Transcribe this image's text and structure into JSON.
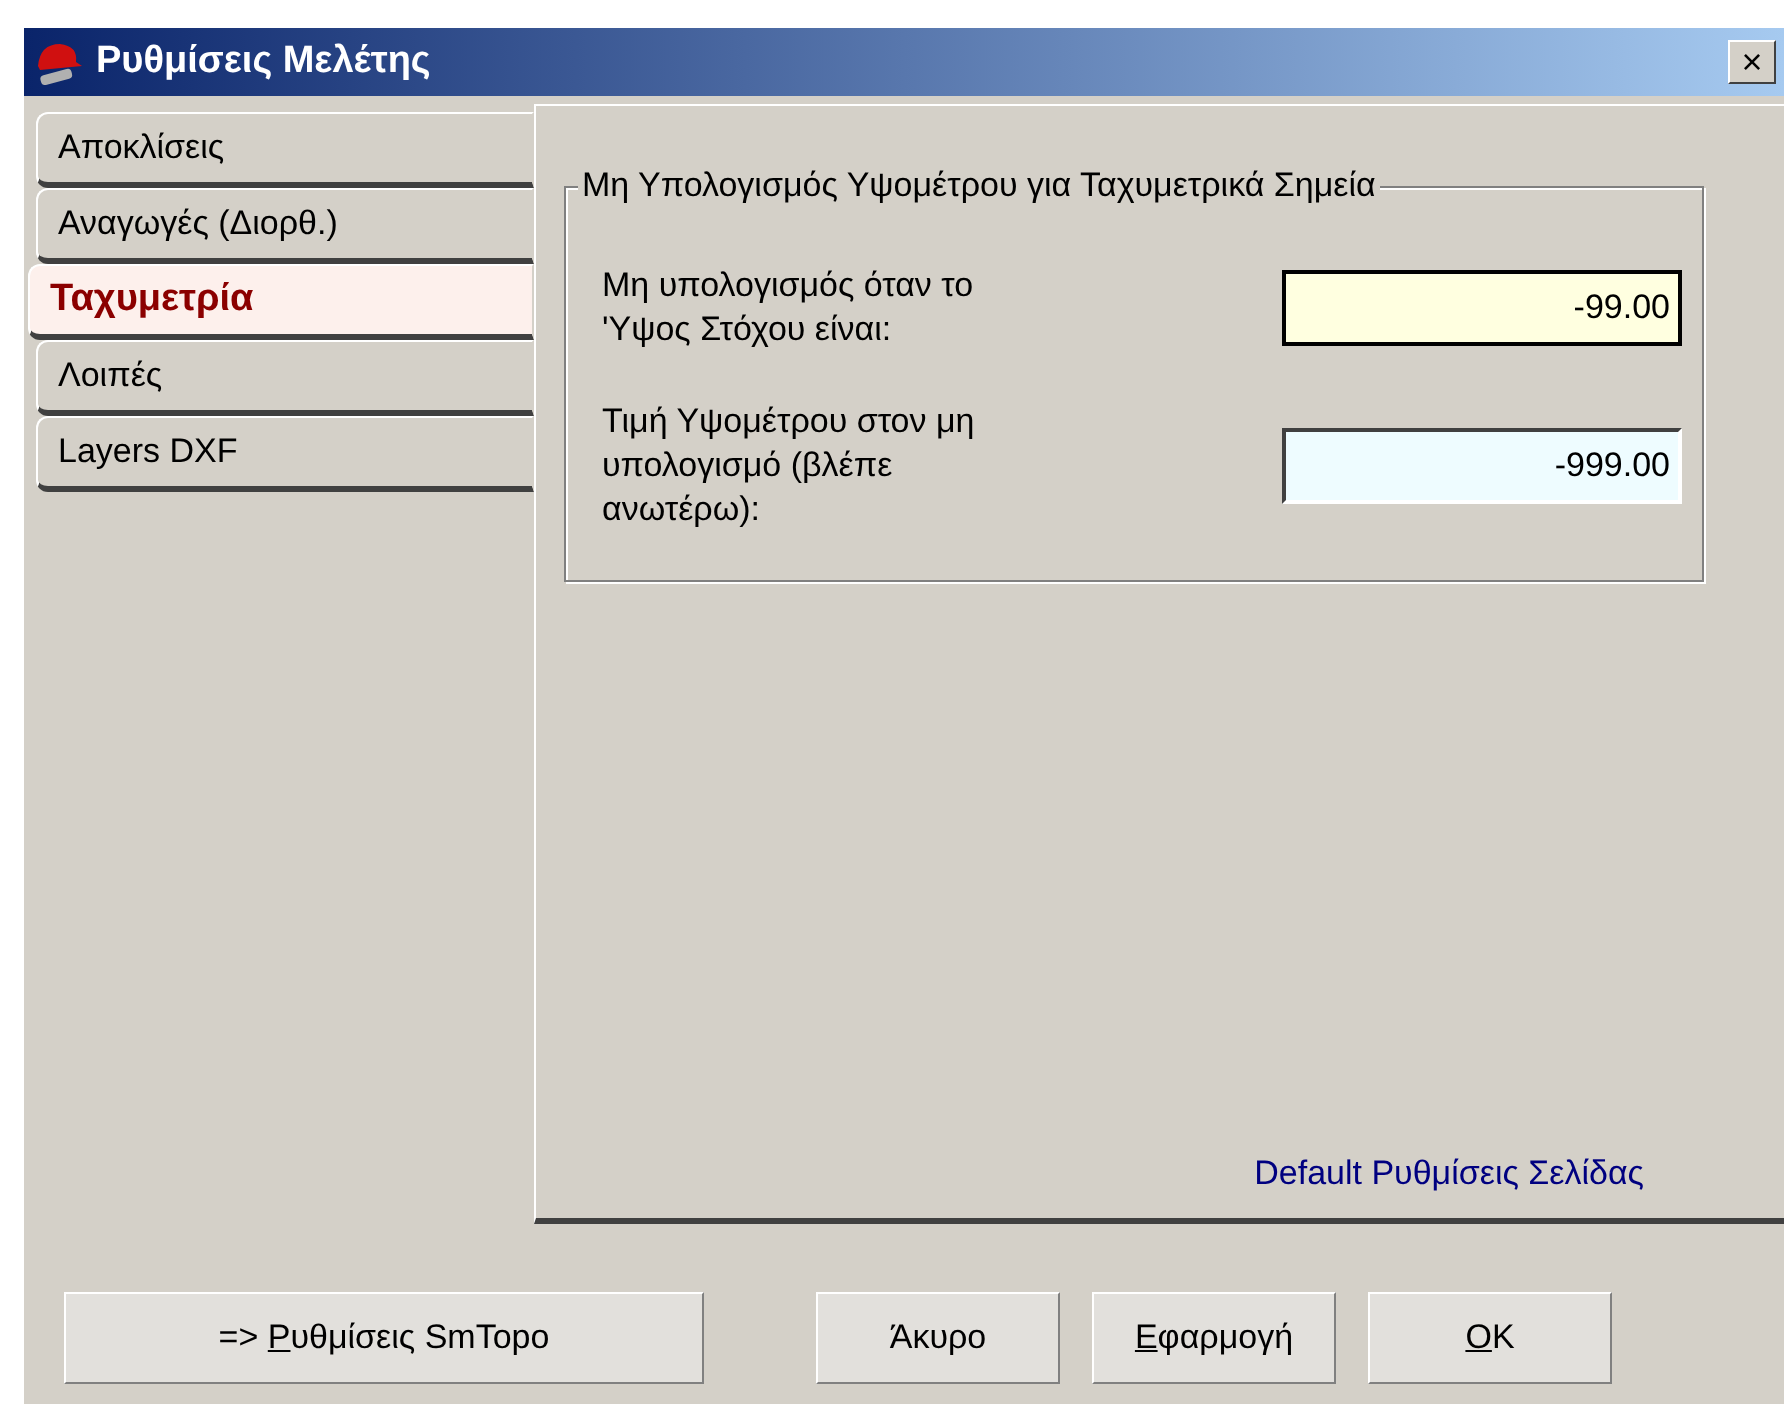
{
  "window": {
    "title": "Ρυθμίσεις Μελέτης",
    "close": "×"
  },
  "tabs": [
    {
      "label": "Αποκλίσεις",
      "selected": false
    },
    {
      "label": "Αναγωγές (Διορθ.)",
      "selected": false
    },
    {
      "label": "Ταχυμετρία",
      "selected": true
    },
    {
      "label": "Λοιπές",
      "selected": false
    },
    {
      "label": "Layers DXF",
      "selected": false
    }
  ],
  "group": {
    "title": "Μη Υπολογισμός Υψομέτρου για Ταχυμετρικά Σημεία",
    "fields": [
      {
        "label": "Μη υπολογισμός όταν το 'Υψος Στόχου είναι:",
        "value": "-99.00",
        "kind": "yellow"
      },
      {
        "label": "Τιμή Υψομέτρου στον μη υπολογισμό (βλέπε ανωτέρω):",
        "value": "-999.00",
        "kind": "blue"
      }
    ]
  },
  "link": "Default Ρυθμίσεις Σελίδας",
  "buttons": [
    {
      "before": "=> ",
      "accel": "Ρ",
      "after": "υθμίσεις SmTopo",
      "kind": "wide"
    },
    {
      "after": "Άκυρο",
      "kind": "normal"
    },
    {
      "accel": "Ε",
      "after": "φαρμογή",
      "kind": "normal"
    },
    {
      "accel": "O",
      "after": "K",
      "kind": "normal"
    }
  ]
}
